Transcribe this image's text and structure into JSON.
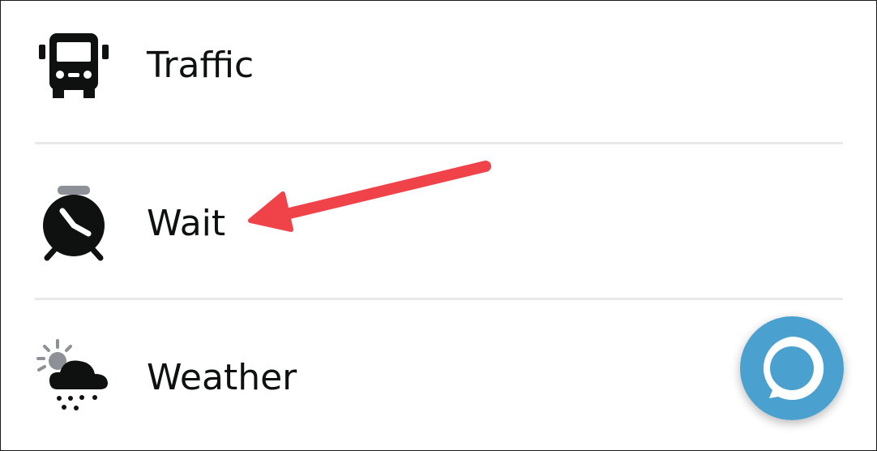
{
  "colors": {
    "text": "#0f1111",
    "icon": "#0f1111",
    "divider": "#e8eaea",
    "annotation_arrow": "#ef4249",
    "alexa_button": "#4aa0cf",
    "alexa_ring": "#ffffff",
    "clock_cap": "#8d9096"
  },
  "items": [
    {
      "label": "Traffic",
      "icon": "bus-icon"
    },
    {
      "label": "Wait",
      "icon": "alarm-clock-icon"
    },
    {
      "label": "Weather",
      "icon": "weather-cloud-icon"
    }
  ],
  "fab": {
    "icon": "alexa-ring-icon"
  }
}
